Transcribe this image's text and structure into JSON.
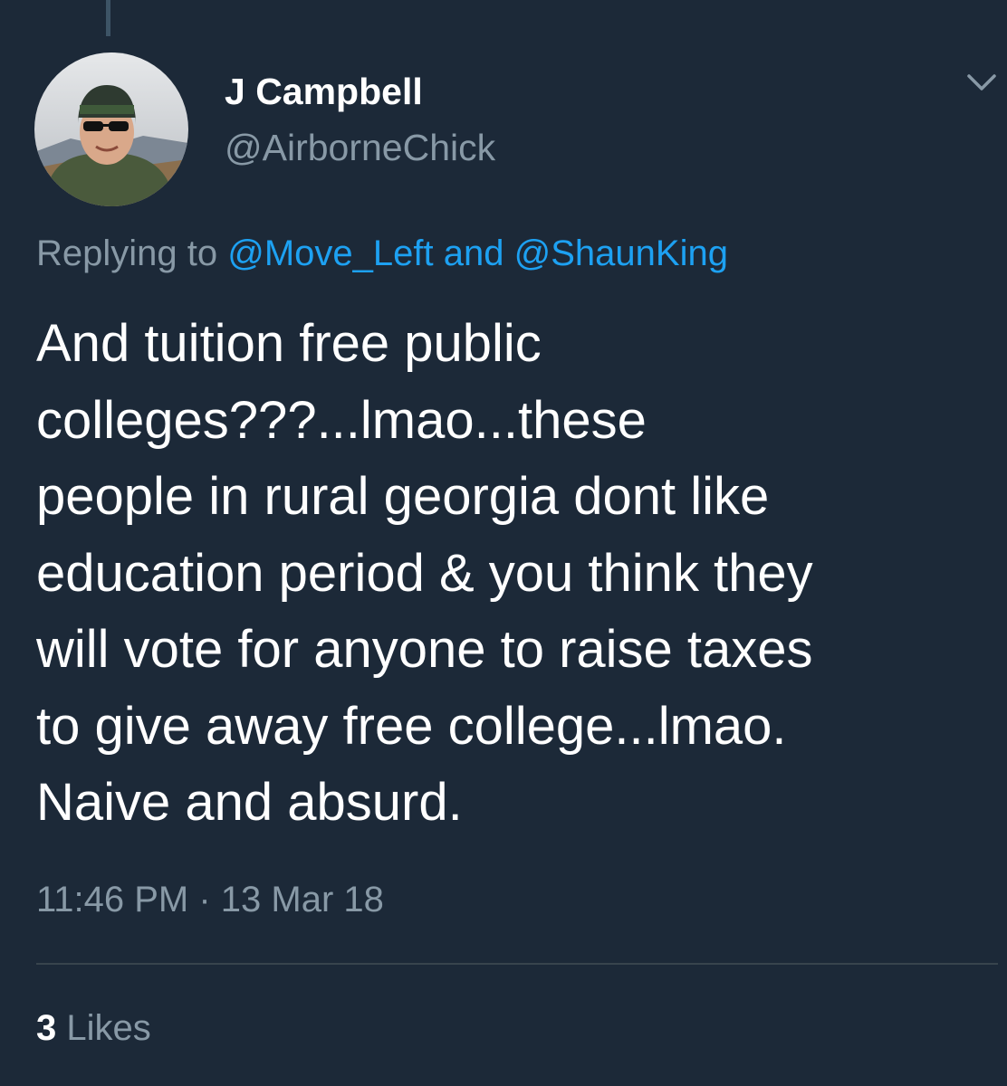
{
  "tweet": {
    "author": {
      "display_name": "J Campbell",
      "handle": "@AirborneChick",
      "avatar_icon": "user-avatar-photo"
    },
    "reply": {
      "prefix": "Replying to",
      "mention_1": "@Move_Left",
      "conjunction": "and",
      "mention_2": "@ShaunKing"
    },
    "text": "And tuition free public\ncolleges???...lmao...these\npeople in rural georgia dont like\neducation period & you think they\nwill vote for anyone to raise taxes\nto give away free college...lmao.\nNaive and absurd.",
    "timestamp": "11:46 PM · 13 Mar 18",
    "likes": {
      "count": "3",
      "label": "Likes"
    },
    "menu_icon": "chevron-down-icon"
  },
  "colors": {
    "background": "#1c2938",
    "primary_text": "#ffffff",
    "secondary_text": "#8899a6",
    "link": "#1da1f2",
    "divider": "#38444d"
  }
}
